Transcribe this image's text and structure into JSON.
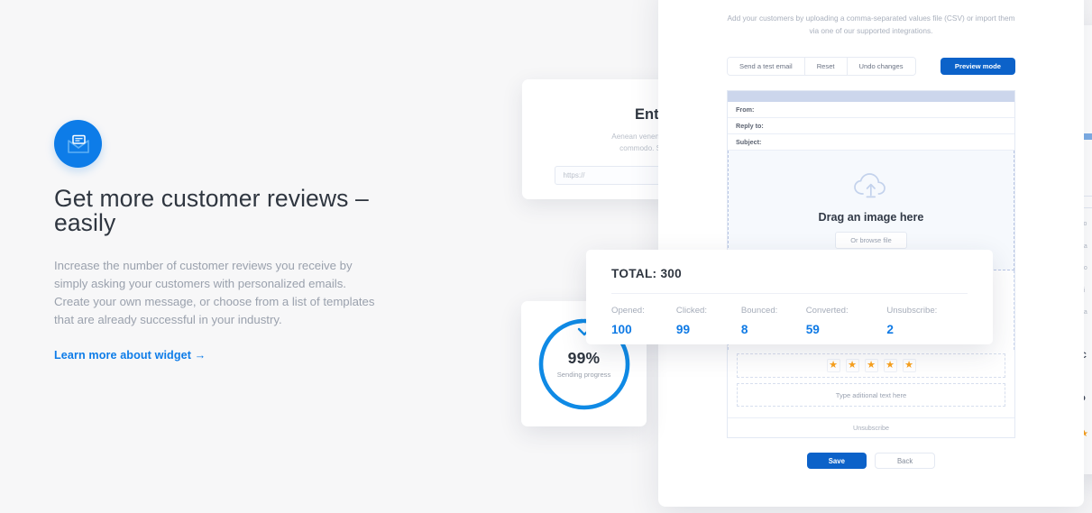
{
  "theme": {
    "page_background": "#f7f7f8",
    "accent_blue": "#0d7ce8",
    "button_blue": "#0c62c9",
    "value_blue": "#0f7ae5",
    "star_orange": "#f9a01b",
    "heading_color": "#2f3640",
    "muted_text": "#9aa1ad"
  },
  "feature": {
    "icon_name": "email-envelope-icon",
    "headline_line1": "Get more customer reviews –",
    "headline_line2": "easily",
    "body": "Increase the number of customer reviews you receive by simply asking your customers with personalized emails. Create your own message, or choose from a list of templates that are already successful in your industry.",
    "link_label": "Learn more about widget",
    "link_arrow": "→"
  },
  "enter_card": {
    "title": "Enter y",
    "subtitle_line1": "Aenean venenatis massa mal",
    "subtitle_line2": "commodo. Sed fermentu",
    "input_placeholder": "https://"
  },
  "main_panel": {
    "description": "Add your customers by uploading a comma-separated values file (CSV) or import them via one of our supported integrations.",
    "toolbar": {
      "send_test_email": "Send a test email",
      "reset": "Reset",
      "undo_changes": "Undo changes",
      "preview_mode": "Preview mode"
    },
    "builder": {
      "from_label": "From:",
      "reply_to_label": "Reply to:",
      "subject_label": "Subject:",
      "dropzone_icon": "cloud-upload-icon",
      "dropzone_title": "Drag an image here",
      "browse_label": "Or browse file",
      "stars": [
        "★",
        "★",
        "★",
        "★",
        "★"
      ],
      "additional_text_placeholder": "Type aditional text here",
      "unsubscribe_label": "Unsubscribe"
    },
    "actions": {
      "save": "Save",
      "back": "Back"
    }
  },
  "progress_card": {
    "percent_label": "99%",
    "caption": "Sending progress",
    "value": 99,
    "chevron_icon": "chevron-down-icon"
  },
  "stats_card": {
    "total_label": "TOTAL: 300",
    "stats": [
      {
        "label": "Opened:",
        "value": "100"
      },
      {
        "label": "Clicked:",
        "value": "99"
      },
      {
        "label": "Bounced:",
        "value": "8"
      },
      {
        "label": "Converted:",
        "value": "59"
      },
      {
        "label": "Unsubscribe:",
        "value": "2"
      }
    ]
  },
  "sliver_card": {
    "line1": "vo",
    "line2": "pa",
    "line3": "uo",
    "line4": "vi",
    "line5": "na",
    "strong1": "C",
    "strong2": "b",
    "star": "★",
    "faint": "p"
  }
}
